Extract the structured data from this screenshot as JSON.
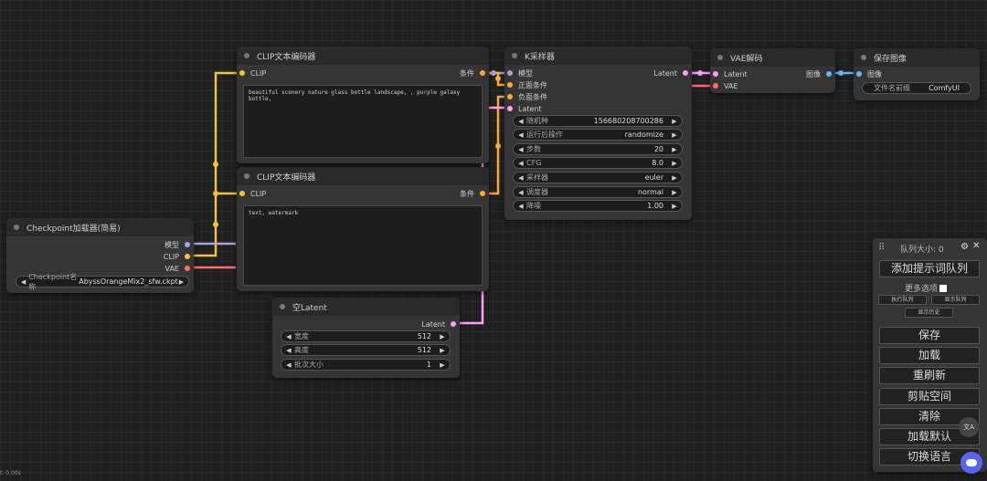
{
  "colors": {
    "clip": "#f2c536",
    "model": "#b39ddb",
    "vae": "#ff6e6e",
    "latent": "#ff9cf9",
    "conditioning": "#ffa931",
    "image": "#64b5f6"
  },
  "nodes": {
    "checkpoint_loader": {
      "title": "Checkpoint加载器(简易)",
      "outputs": [
        "模型",
        "CLIP",
        "VAE"
      ],
      "widget": {
        "label": "Checkpoint名称",
        "value": "AbyssOrangeMix2_sfw.ckpt"
      }
    },
    "clip_encode_positive": {
      "title": "CLIP文本编码器",
      "input": "CLIP",
      "output": "条件",
      "text": "beautiful scenery nature glass bottle landscape, , purple galaxy bottle,"
    },
    "clip_encode_negative": {
      "title": "CLIP文本编码器",
      "input": "CLIP",
      "output": "条件",
      "text": "text, watermark"
    },
    "empty_latent": {
      "title": "空Latent",
      "output": "Latent",
      "widgets": [
        {
          "label": "宽度",
          "value": "512"
        },
        {
          "label": "高度",
          "value": "512"
        },
        {
          "label": "批次大小",
          "value": "1"
        }
      ]
    },
    "ksampler": {
      "title": "K采样器",
      "inputs": [
        "模型",
        "正面条件",
        "负面条件",
        "Latent"
      ],
      "output": "Latent",
      "widgets": [
        {
          "label": "随机种",
          "value": "156680208700286"
        },
        {
          "label": "运行后操作",
          "value": "randomize"
        },
        {
          "label": "步数",
          "value": "20"
        },
        {
          "label": "CFG",
          "value": "8.0"
        },
        {
          "label": "采样器",
          "value": "euler"
        },
        {
          "label": "调度器",
          "value": "normal"
        },
        {
          "label": "降噪",
          "value": "1.00"
        }
      ]
    },
    "vae_decode": {
      "title": "VAE解码",
      "inputs": [
        "Latent",
        "VAE"
      ],
      "output": "图像"
    },
    "save_image": {
      "title": "保存图像",
      "input": "图像",
      "widget": {
        "label": "文件名前缀",
        "value": "ComfyUI"
      }
    }
  },
  "queue_panel": {
    "title": "队列大小: 0",
    "queue_prompt": "添加提示词队列",
    "extra_options": "更多选项",
    "view_queue": "执行队列",
    "view_history": "显示队列",
    "show_history": "显示历史",
    "buttons": [
      "保存",
      "加载",
      "重刷新",
      "剪贴空间",
      "清除",
      "加载默认",
      "切换语言"
    ]
  },
  "status_text": "t: 0.00s"
}
